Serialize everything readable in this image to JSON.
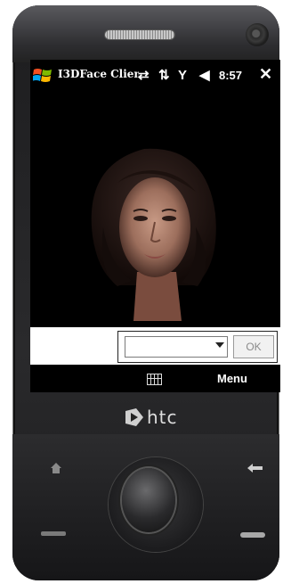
{
  "device": {
    "brand": "htc"
  },
  "status_bar": {
    "app_title": "I3DFace Client",
    "time": "8:57",
    "close_label": "✕",
    "icons": [
      "windows-start-icon",
      "sync-icon",
      "data-arrows-icon",
      "signal-icon",
      "volume-icon"
    ]
  },
  "controls": {
    "combo_value": "",
    "ok_label": "OK"
  },
  "softkeys": {
    "left_icon": "keyboard-icon",
    "right_label": "Menu"
  },
  "hardware_buttons": [
    "home-icon",
    "back-arrow-icon",
    "call-icon",
    "end-call-icon",
    "navigation-wheel"
  ],
  "colors": {
    "screen_bg": "#000000",
    "ok_text": "#8a8a8a"
  }
}
